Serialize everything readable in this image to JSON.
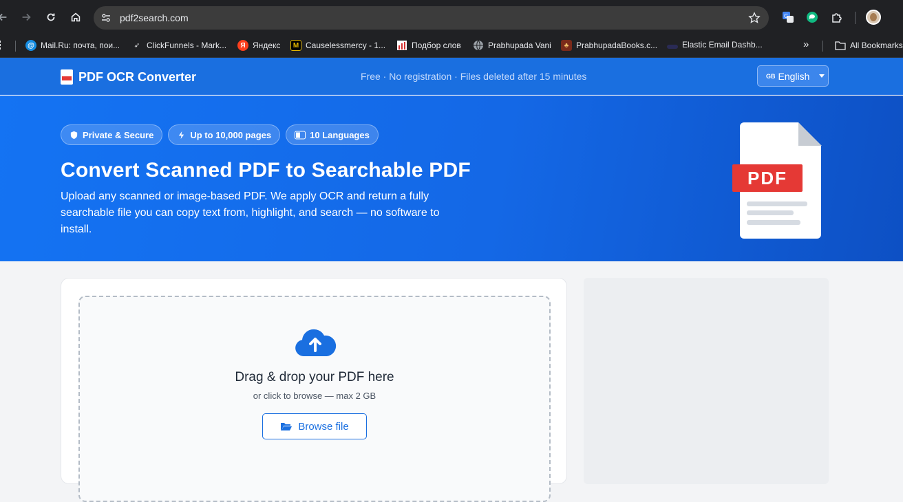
{
  "browser": {
    "url": "pdf2search.com",
    "bookmarks": [
      {
        "label": "Mail.Ru: почта, пои...",
        "icon": "at-icon"
      },
      {
        "label": "ClickFunnels - Mark...",
        "icon": "cursor-icon"
      },
      {
        "label": "Яндекс",
        "icon": "yandex-icon"
      },
      {
        "label": "Causelessmercy - 1...",
        "icon": "m-icon"
      },
      {
        "label": "Подбор слов",
        "icon": "bars-icon"
      },
      {
        "label": "Prabhupada Vani",
        "icon": "globe-icon"
      },
      {
        "label": "PrabhupadaBooks.c...",
        "icon": "figure-icon"
      },
      {
        "label": "Elastic Email Dashb...",
        "icon": "elastic-icon"
      }
    ],
    "more_label": "»",
    "all_bookmarks": "All Bookmarks"
  },
  "header": {
    "logo": "PDF OCR Converter",
    "tagline": "Free · No registration · Files deleted after 15 minutes",
    "lang_flag": "GB",
    "lang_label": "English"
  },
  "hero": {
    "pills": [
      "Private & Secure",
      "Up to 10,000 pages",
      "10 Languages"
    ],
    "title": "Convert Scanned PDF to Searchable PDF",
    "desc": "Upload any scanned or image-based PDF. We apply OCR and return a fully searchable file you can copy text from, highlight, and search — no software to install.",
    "badge": "PDF"
  },
  "upload": {
    "title": "Drag & drop your PDF here",
    "subtitle": "or click to browse — max 2 GB",
    "browse_label": "Browse file"
  },
  "colors": {
    "brand_blue": "#1a6fe0",
    "pdf_red": "#e53935"
  }
}
